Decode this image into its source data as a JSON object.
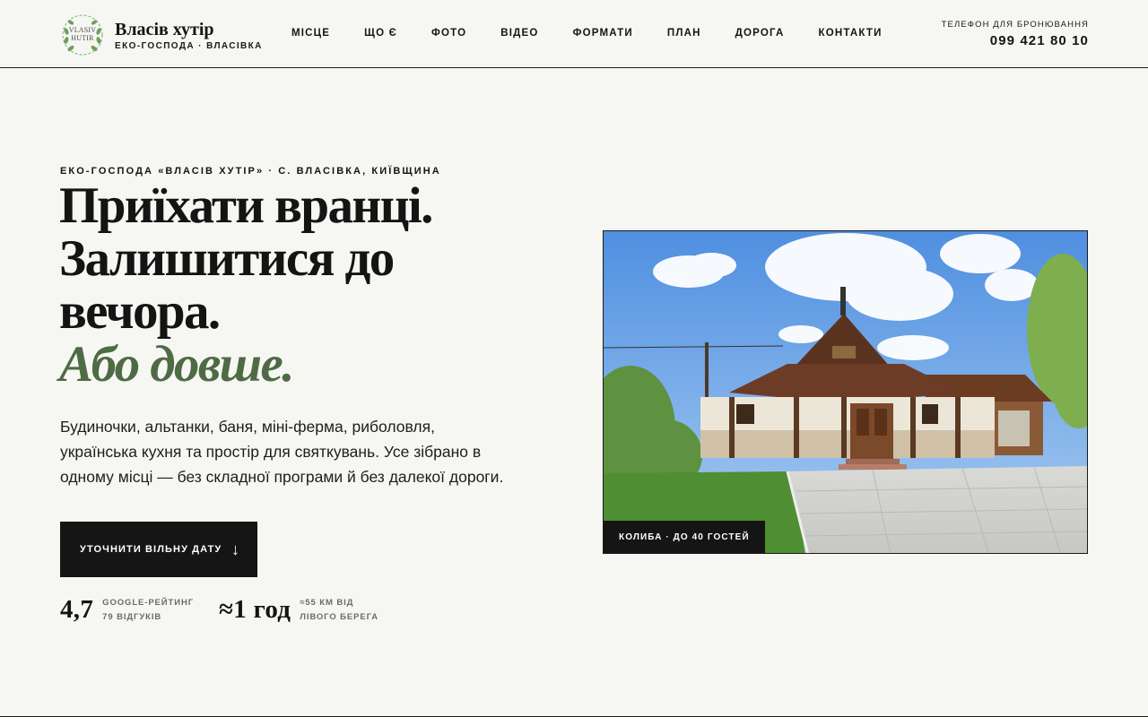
{
  "header": {
    "logo_text_1": "VLASIV",
    "logo_text_2": "HUTIR",
    "brand_name": "Власів хутір",
    "brand_sub": "ЕКО-ГОСПОДА · ВЛАСІВКА",
    "nav": [
      "МІСЦЕ",
      "ЩО Є",
      "ФОТО",
      "ВІДЕО",
      "ФОРМАТИ",
      "ПЛАН",
      "ДОРОГА",
      "КОНТАКТИ"
    ],
    "phone_label": "ТЕЛЕФОН ДЛЯ БРОНЮВАННЯ",
    "phone_number": "099 421 80 10"
  },
  "hero": {
    "eyebrow": "ЕКО-ГОСПОДА «ВЛАСІВ ХУТІР» · С. ВЛАСІВКА, КИЇВЩИНА",
    "headline_lines": [
      "Приїхати вранці.",
      "Залишитися до",
      "вечора."
    ],
    "headline_accent": "Або довше.",
    "lead": "Будиночки, альтанки, баня, міні-ферма, риболовля, українська кухня та простір для святкувань. Усе зібрано в одному місці — без складної програми й без далекої дороги.",
    "cta_label": "УТОЧНИТИ ВІЛЬНУ ДАТУ",
    "cta_arrow": "↓",
    "stats": [
      {
        "value": "4,7",
        "desc_1": "GOOGLE-РЕЙТИНГ",
        "desc_2": "79 ВІДГУКІВ"
      },
      {
        "value": "≈1 год",
        "desc_1": "≈55 КМ ВІД",
        "desc_2": "ЛІВОГО БЕРЕГА"
      }
    ],
    "photo_caption": "КОЛИБА · ДО 40 ГОСТЕЙ"
  },
  "colors": {
    "background": "#f6f7f2",
    "ink": "#141414",
    "accent_green": "#4e6b46",
    "button": "#151515"
  }
}
